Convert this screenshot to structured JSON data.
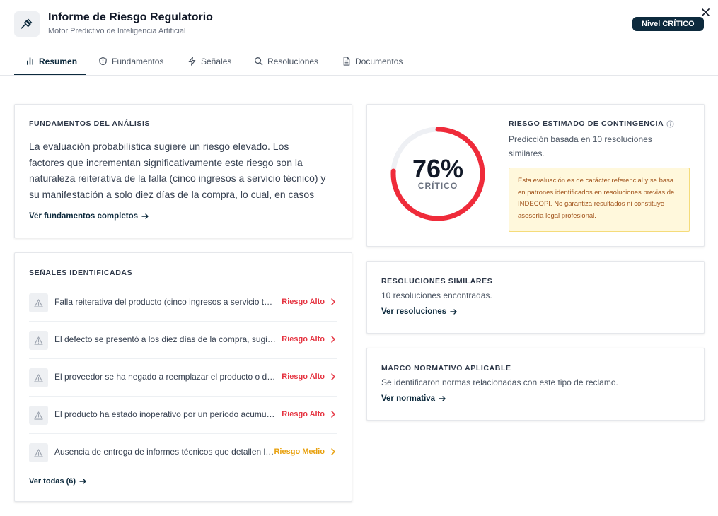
{
  "header": {
    "title": "Informe de Riesgo Regulatorio",
    "subtitle": "Motor Predictivo de Inteligencia Artificial",
    "level_badge": "Nivel CRÍTICO"
  },
  "tabs": [
    {
      "label": "Resumen",
      "icon": "bar-chart-icon",
      "active": true
    },
    {
      "label": "Fundamentos",
      "icon": "shield-icon",
      "active": false
    },
    {
      "label": "Señales",
      "icon": "lightning-icon",
      "active": false
    },
    {
      "label": "Resoluciones",
      "icon": "search-icon",
      "active": false
    },
    {
      "label": "Documentos",
      "icon": "document-icon",
      "active": false
    }
  ],
  "fundamentos": {
    "title": "FUNDAMENTOS DEL ANÁLISIS",
    "text": "La evaluación probabilística sugiere un riesgo elevado. Los factores que incrementan significativamente este riesgo son la naturaleza reiterativa de la falla (cinco ingresos a servicio técnico) y su manifestación a solo diez días de la compra, lo cual, en casos …",
    "link": "Ver fundamentos completos"
  },
  "risk": {
    "title": "RIESGO ESTIMADO DE CONTINGENCIA",
    "percent_label": "76%",
    "percent_value": 76,
    "level": "CRÍTICO",
    "description": "Predicción basada en 10 resoluciones similares.",
    "disclaimer": "Esta evaluación es de carácter referencial y se basa en patrones identificados en resoluciones previas de INDECOPI. No garantiza resultados ni constituye asesoría legal profesional.",
    "ring_color": "#ef2b3a",
    "track_color": "#eef0f4"
  },
  "signals": {
    "title": "SEÑALES IDENTIFICADAS",
    "items": [
      {
        "text": "Falla reiterativa del producto (cinco ingresos a servicio técnico)",
        "level": "Riesgo Alto",
        "color": "#e53340"
      },
      {
        "text": "El defecto se presentó a los diez días de la compra, sugiriendo un defecto de origen",
        "level": "Riesgo Alto",
        "color": "#e53340"
      },
      {
        "text": "El proveedor se ha negado a reemplazar el producto o devolver el dinero",
        "level": "Riesgo Alto",
        "color": "#e53340"
      },
      {
        "text": "El producto ha estado inoperativo por un período acumulado prolongado",
        "level": "Riesgo Alto",
        "color": "#e53340"
      },
      {
        "text": "Ausencia de entrega de informes técnicos que detallen las reparaciones",
        "level": "Riesgo Medio",
        "color": "#e8a00c"
      }
    ],
    "link": "Ver todas (6)"
  },
  "resoluciones": {
    "title": "RESOLUCIONES SIMILARES",
    "description": "10 resoluciones encontradas.",
    "link": "Ver resoluciones"
  },
  "marco": {
    "title": "MARCO NORMATIVO APLICABLE",
    "description": "Se identificaron normas relacionadas con este tipo de reclamo.",
    "link": "Ver normativa"
  }
}
